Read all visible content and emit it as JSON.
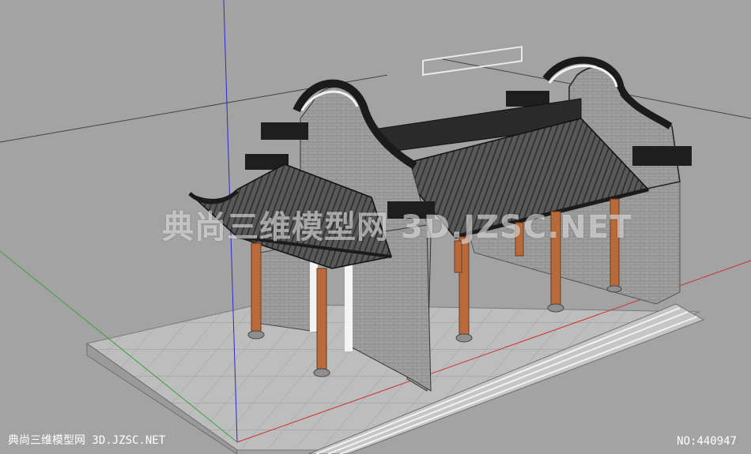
{
  "watermark": {
    "text": "典尚三维模型网 3D.JZSC.NET"
  },
  "footer": {
    "site": "典尚三维模型网 3D.JZSC.NET",
    "id_label": "NO:440947"
  },
  "colors": {
    "background": "#a3a3a3",
    "ground_tile": "#bcbcbc",
    "wall": "#9d9d9d",
    "roof": "#565656",
    "roof_trim": "#1b1b1b",
    "column": "#b86a3a",
    "axis_red": "#d03030",
    "axis_green": "#3aa33a",
    "axis_blue": "#2a2ad0"
  }
}
